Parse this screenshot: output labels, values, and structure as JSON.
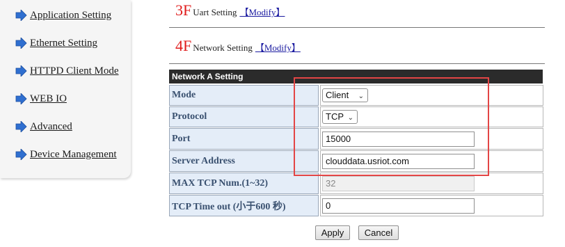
{
  "sidebar": {
    "items": [
      {
        "label": "Application Setting"
      },
      {
        "label": "Ethernet Setting"
      },
      {
        "label": "HTTPD Client Mode"
      },
      {
        "label": "WEB IO"
      },
      {
        "label": "Advanced"
      },
      {
        "label": "Device Management"
      }
    ]
  },
  "sections": {
    "uart": {
      "num": "3F",
      "title": "Uart Setting",
      "modify": "【Modify】"
    },
    "network": {
      "num": "4F",
      "title": "Network Setting",
      "modify": "【Modify】"
    }
  },
  "table": {
    "title": "Network A Setting",
    "rows": [
      {
        "label": "Mode",
        "value": "Client"
      },
      {
        "label": "Protocol",
        "value": "TCP"
      },
      {
        "label": "Port",
        "value": "15000"
      },
      {
        "label": "Server Address",
        "value": "clouddata.usriot.com"
      },
      {
        "label": "MAX TCP Num.(1~32)",
        "value": "32"
      },
      {
        "label": "TCP Time out (小于600 秒)",
        "value": "0"
      }
    ]
  },
  "buttons": {
    "apply": "Apply",
    "cancel": "Cancel"
  },
  "colors": {
    "accent_red": "#e01b1b",
    "highlight_box": "#e34545",
    "label_bg": "#e4edf8",
    "header_bg": "#2b2b2b"
  }
}
